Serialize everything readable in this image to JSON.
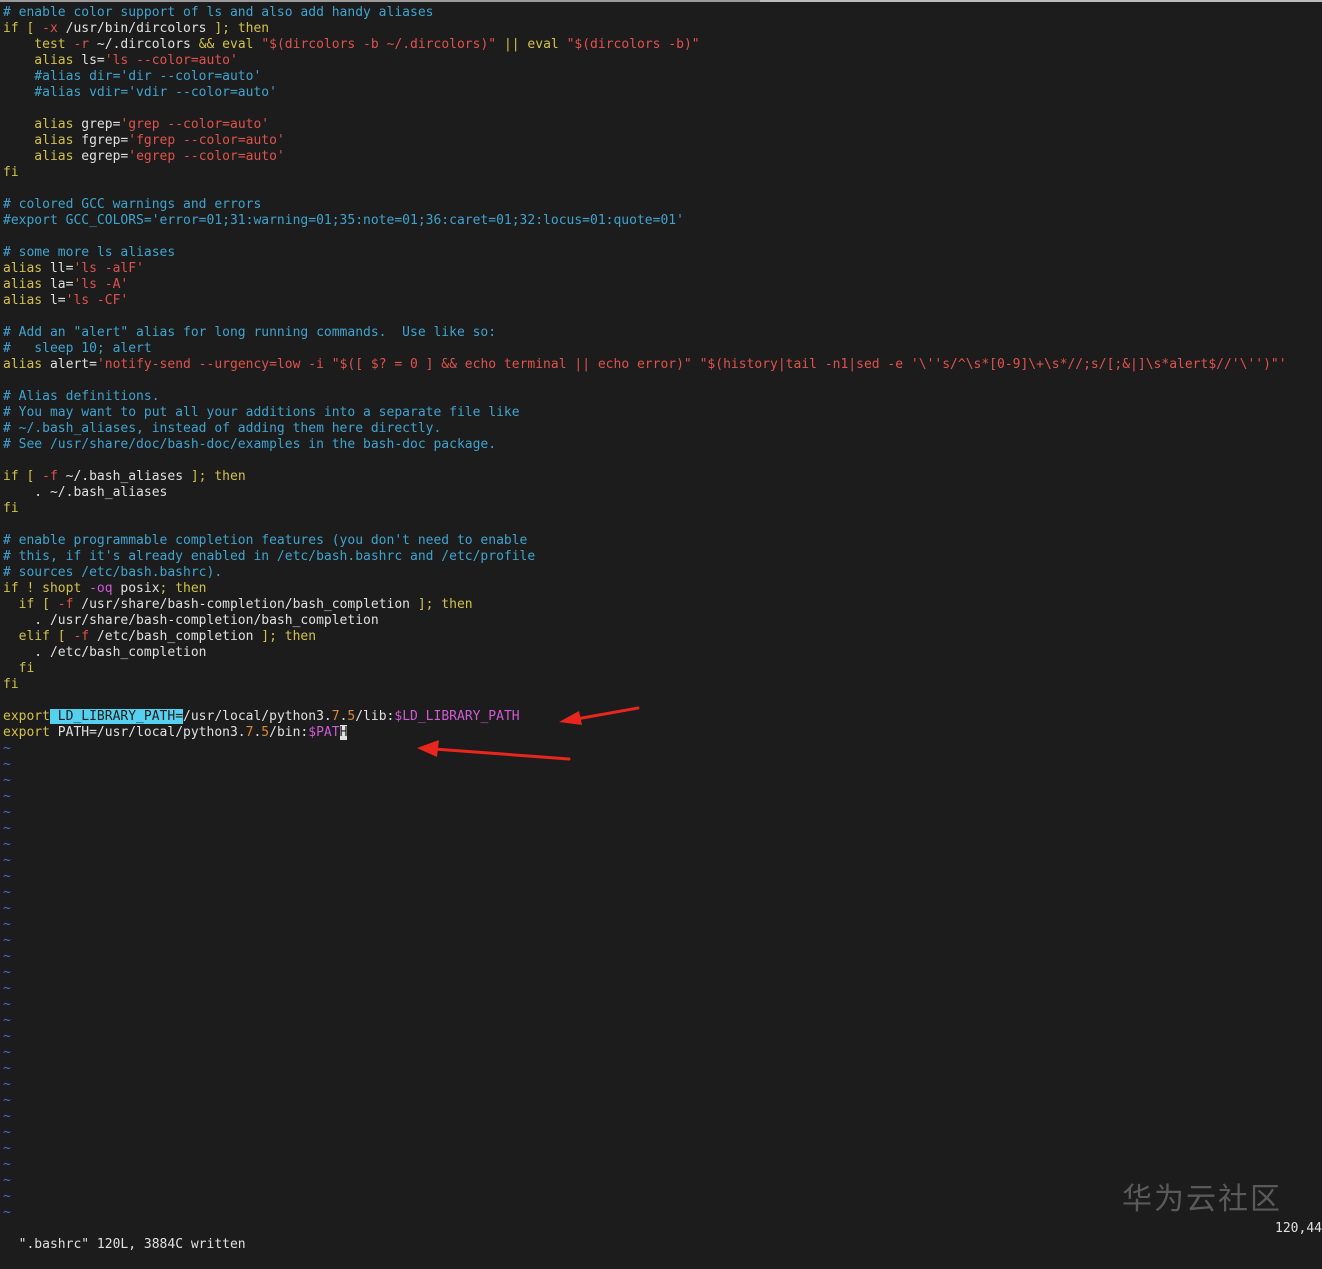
{
  "editor": {
    "lines": [
      [
        {
          "t": "# enable color support of ls and also add handy aliases",
          "c": "c"
        }
      ],
      [
        {
          "t": "if [ ",
          "c": "k"
        },
        {
          "t": "-x",
          "c": "s"
        },
        {
          "t": " /usr/bin/dircolors ",
          "c": "w"
        },
        {
          "t": "]; then",
          "c": "k"
        }
      ],
      [
        {
          "t": "    test ",
          "c": "k"
        },
        {
          "t": "-r",
          "c": "s"
        },
        {
          "t": " ~/.dircolors ",
          "c": "w"
        },
        {
          "t": "&& eval ",
          "c": "k"
        },
        {
          "t": "\"$(dircolors -b ~/.dircolors)\"",
          "c": "s"
        },
        {
          "t": " || eval ",
          "c": "k"
        },
        {
          "t": "\"$(dircolors -b)\"",
          "c": "s"
        }
      ],
      [
        {
          "t": "    alias ",
          "c": "k"
        },
        {
          "t": "ls=",
          "c": "w"
        },
        {
          "t": "'ls --color=auto'",
          "c": "s"
        }
      ],
      [
        {
          "t": "    #alias dir='dir --color=auto'",
          "c": "c"
        }
      ],
      [
        {
          "t": "    #alias vdir='vdir --color=auto'",
          "c": "c"
        }
      ],
      [
        {
          "t": "",
          "c": "w"
        }
      ],
      [
        {
          "t": "    alias ",
          "c": "k"
        },
        {
          "t": "grep=",
          "c": "w"
        },
        {
          "t": "'grep --color=auto'",
          "c": "s"
        }
      ],
      [
        {
          "t": "    alias ",
          "c": "k"
        },
        {
          "t": "fgrep=",
          "c": "w"
        },
        {
          "t": "'fgrep --color=auto'",
          "c": "s"
        }
      ],
      [
        {
          "t": "    alias ",
          "c": "k"
        },
        {
          "t": "egrep=",
          "c": "w"
        },
        {
          "t": "'egrep --color=auto'",
          "c": "s"
        }
      ],
      [
        {
          "t": "fi",
          "c": "k"
        }
      ],
      [
        {
          "t": "",
          "c": "w"
        }
      ],
      [
        {
          "t": "# colored GCC warnings and errors",
          "c": "c"
        }
      ],
      [
        {
          "t": "#export GCC_COLORS='error=01;31:warning=01;35:note=01;36:caret=01;32:locus=01:quote=01'",
          "c": "c"
        }
      ],
      [
        {
          "t": "",
          "c": "w"
        }
      ],
      [
        {
          "t": "# some more ls aliases",
          "c": "c"
        }
      ],
      [
        {
          "t": "alias ",
          "c": "k"
        },
        {
          "t": "ll=",
          "c": "w"
        },
        {
          "t": "'ls -alF'",
          "c": "s"
        }
      ],
      [
        {
          "t": "alias ",
          "c": "k"
        },
        {
          "t": "la=",
          "c": "w"
        },
        {
          "t": "'ls -A'",
          "c": "s"
        }
      ],
      [
        {
          "t": "alias ",
          "c": "k"
        },
        {
          "t": "l=",
          "c": "w"
        },
        {
          "t": "'ls -CF'",
          "c": "s"
        }
      ],
      [
        {
          "t": "",
          "c": "w"
        }
      ],
      [
        {
          "t": "# Add an \"alert\" alias for long running commands.  Use like so:",
          "c": "c"
        }
      ],
      [
        {
          "t": "#   sleep 10; alert",
          "c": "c"
        }
      ],
      [
        {
          "t": "alias ",
          "c": "k"
        },
        {
          "t": "alert=",
          "c": "w"
        },
        {
          "t": "'notify-send --urgency=low -i \"$([ $? = 0 ] && echo terminal || echo error)\" \"$(history|tail -n1|sed -e '\\''s/^\\s*[0-9]\\+\\s*//;s/[;&|]\\s*alert$//'\\'')\"'",
          "c": "s"
        }
      ],
      [
        {
          "t": "",
          "c": "w"
        }
      ],
      [
        {
          "t": "# Alias definitions.",
          "c": "c"
        }
      ],
      [
        {
          "t": "# You may want to put all your additions into a separate file like",
          "c": "c"
        }
      ],
      [
        {
          "t": "# ~/.bash_aliases, instead of adding them here directly.",
          "c": "c"
        }
      ],
      [
        {
          "t": "# See /usr/share/doc/bash-doc/examples in the bash-doc package.",
          "c": "c"
        }
      ],
      [
        {
          "t": "",
          "c": "w"
        }
      ],
      [
        {
          "t": "if [ ",
          "c": "k"
        },
        {
          "t": "-f",
          "c": "s"
        },
        {
          "t": " ~/.bash_aliases ",
          "c": "w"
        },
        {
          "t": "]; then",
          "c": "k"
        }
      ],
      [
        {
          "t": "    . ~/.bash_aliases",
          "c": "w"
        }
      ],
      [
        {
          "t": "fi",
          "c": "k"
        }
      ],
      [
        {
          "t": "",
          "c": "w"
        }
      ],
      [
        {
          "t": "# enable programmable completion features (you don't need to enable",
          "c": "c"
        }
      ],
      [
        {
          "t": "# this, if it's already enabled in /etc/bash.bashrc and /etc/profile",
          "c": "c"
        }
      ],
      [
        {
          "t": "# sources /etc/bash.bashrc).",
          "c": "c"
        }
      ],
      [
        {
          "t": "if ! shopt ",
          "c": "k"
        },
        {
          "t": "-oq",
          "c": "v"
        },
        {
          "t": " posix",
          "c": "w"
        },
        {
          "t": "; then",
          "c": "k"
        }
      ],
      [
        {
          "t": "  if [ ",
          "c": "k"
        },
        {
          "t": "-f",
          "c": "s"
        },
        {
          "t": " /usr/share/bash-completion/bash_completion ",
          "c": "w"
        },
        {
          "t": "]; then",
          "c": "k"
        }
      ],
      [
        {
          "t": "    . /usr/share/bash-completion/bash_completion",
          "c": "w"
        }
      ],
      [
        {
          "t": "  elif [ ",
          "c": "k"
        },
        {
          "t": "-f",
          "c": "s"
        },
        {
          "t": " /etc/bash_completion ",
          "c": "w"
        },
        {
          "t": "]; then",
          "c": "k"
        }
      ],
      [
        {
          "t": "    . /etc/bash_completion",
          "c": "w"
        }
      ],
      [
        {
          "t": "  fi",
          "c": "k"
        }
      ],
      [
        {
          "t": "fi",
          "c": "k"
        }
      ],
      [
        {
          "t": "",
          "c": "w"
        }
      ],
      [
        {
          "t": "export",
          "c": "k"
        },
        {
          "t": " LD_LIBRARY_PATH=",
          "c": "hl"
        },
        {
          "t": "/usr/local/python3.",
          "c": "w"
        },
        {
          "t": "7",
          "c": "n"
        },
        {
          "t": ".",
          "c": "w"
        },
        {
          "t": "5",
          "c": "n"
        },
        {
          "t": "/lib:",
          "c": "w"
        },
        {
          "t": "$LD_LIBRARY_PATH",
          "c": "v"
        }
      ],
      [
        {
          "t": "export",
          "c": "k"
        },
        {
          "t": " PATH=/usr/local/python3.",
          "c": "w"
        },
        {
          "t": "7",
          "c": "n"
        },
        {
          "t": ".",
          "c": "w"
        },
        {
          "t": "5",
          "c": "n"
        },
        {
          "t": "/bin:",
          "c": "w"
        },
        {
          "t": "$PAT",
          "c": "v"
        },
        {
          "t": "H",
          "c": "cur"
        }
      ]
    ],
    "tilde_count": 30,
    "tilde_char": "~"
  },
  "status": {
    "message": "\".bashrc\" 120L, 3884C written",
    "position": "120,44"
  },
  "watermark": {
    "text": "华为云社区"
  },
  "colors": {
    "background": "#1c1c1c",
    "comment": "#3ea4cf",
    "keyword": "#d3c247",
    "string": "#e0524c",
    "variable": "#cf5ad6",
    "highlight": "#55d0ee",
    "annotation_arrow": "#e8261e"
  }
}
